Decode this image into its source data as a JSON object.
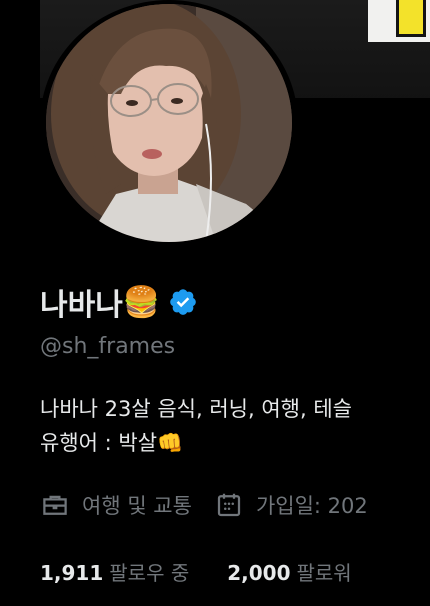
{
  "profile": {
    "display_name": "나바나",
    "name_emoji": "🍔",
    "handle": "@sh_frames",
    "bio_line1": "나바나 23살 음식, 러닝, 여행, 테슬",
    "bio_line2": "유행어 : 박살👊"
  },
  "meta": {
    "category": "여행 및 교통",
    "category_icon": "briefcase-icon",
    "joined": "가입일: 202",
    "joined_icon": "calendar-icon"
  },
  "stats": {
    "following_count": "1,911",
    "following_label": "팔로우 중",
    "followers_count": "2,000",
    "followers_label": "팔로워"
  },
  "colors": {
    "background": "#000000",
    "text_primary": "#e7e9ea",
    "text_secondary": "#71767b",
    "verified_blue": "#1d9bf0"
  }
}
